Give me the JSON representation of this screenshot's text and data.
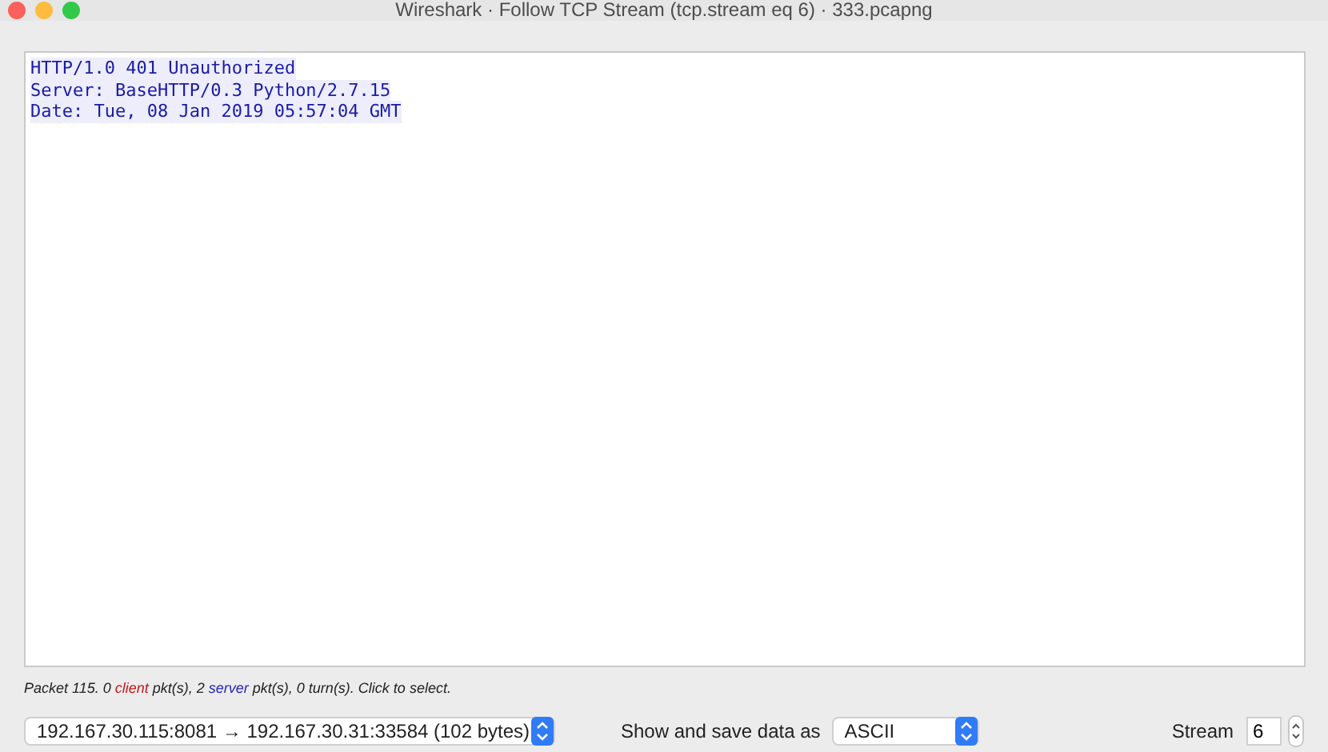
{
  "window": {
    "title": "Wireshark · Follow TCP Stream (tcp.stream eq 6) · 333.pcapng"
  },
  "stream_lines": [
    {
      "kind": "server",
      "text": "HTTP/1.0 401 Unauthorized"
    },
    {
      "kind": "server",
      "text": "Server: BaseHTTP/0.3 Python/2.7.15"
    },
    {
      "kind": "server",
      "text": "Date: Tue, 08 Jan 2019 05:57:04 GMT"
    }
  ],
  "status_segments": [
    {
      "kind": "plain",
      "text": "Packet 115. 0 "
    },
    {
      "kind": "client",
      "text": "client"
    },
    {
      "kind": "plain",
      "text": " pkt(s), 2 "
    },
    {
      "kind": "server",
      "text": "server"
    },
    {
      "kind": "plain",
      "text": " pkt(s), 0 turn(s). Click to select."
    }
  ],
  "conversation_select": {
    "value": "192.167.30.115:8081 → 192.167.30.31:33584 (102 bytes)"
  },
  "data_format": {
    "label": "Show and save data as",
    "value": "ASCII"
  },
  "stream": {
    "label": "Stream",
    "value": "6"
  }
}
